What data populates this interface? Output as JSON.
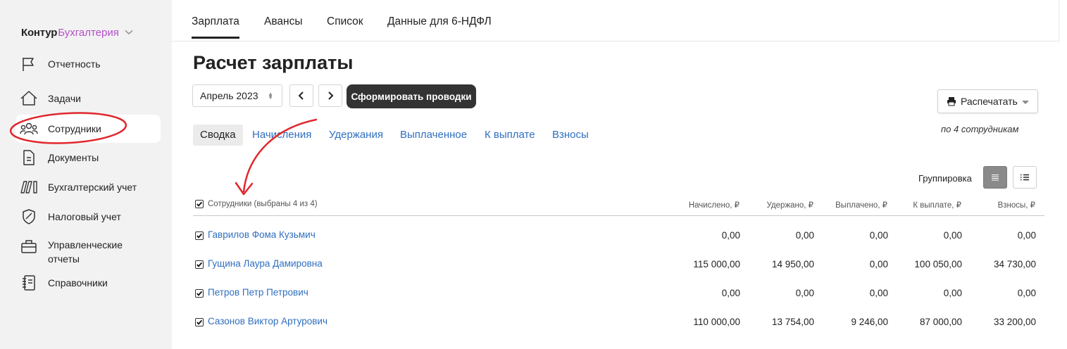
{
  "logo": {
    "kontur": "Контур",
    "product": "Бухгалтерия"
  },
  "sidebar": {
    "items": [
      {
        "label": "Отчетность",
        "icon": "flag-icon"
      },
      {
        "label": "Задачи",
        "icon": "home-icon"
      },
      {
        "label": "Сотрудники",
        "icon": "people-icon"
      },
      {
        "label": "Документы",
        "icon": "document-icon"
      },
      {
        "label": "Бухгалтерский учет",
        "icon": "ledger-icon"
      },
      {
        "label": "Налоговый учет",
        "icon": "shield-icon"
      },
      {
        "label": "Управленческие отчеты",
        "icon": "briefcase-icon"
      },
      {
        "label": "Справочники",
        "icon": "notebook-icon"
      }
    ]
  },
  "top_tabs": [
    "Зарплата",
    "Авансы",
    "Список",
    "Данные для 6-НДФЛ"
  ],
  "page": {
    "title": "Расчет зарплаты",
    "period": "Апрель 2023",
    "generate_button": "Сформировать проводки",
    "print_button": "Распечатать",
    "print_note": "по 4 сотрудникам",
    "grouping_label": "Группировка"
  },
  "sub_tabs": [
    "Сводка",
    "Начисления",
    "Удержания",
    "Выплаченное",
    "К выплате",
    "Взносы"
  ],
  "table": {
    "headers": {
      "employees": "Сотрудники (выбраны 4 из 4)",
      "accrued": "Начислено, ₽",
      "withheld": "Удержано, ₽",
      "paid": "Выплачено, ₽",
      "to_pay": "К выплате, ₽",
      "contributions": "Взносы, ₽"
    },
    "rows": [
      {
        "name": "Гаврилов Фома Кузьмич",
        "accrued": "0,00",
        "withheld": "0,00",
        "paid": "0,00",
        "to_pay": "0,00",
        "contributions": "0,00"
      },
      {
        "name": "Гущина Лаура Дамировна",
        "accrued": "115 000,00",
        "withheld": "14 950,00",
        "paid": "0,00",
        "to_pay": "100 050,00",
        "contributions": "34 730,00"
      },
      {
        "name": "Петров Петр Петрович",
        "accrued": "0,00",
        "withheld": "0,00",
        "paid": "0,00",
        "to_pay": "0,00",
        "contributions": "0,00"
      },
      {
        "name": "Сазонов Виктор Артурович",
        "accrued": "110 000,00",
        "withheld": "13 754,00",
        "paid": "9 246,00",
        "to_pay": "87 000,00",
        "contributions": "33 200,00"
      }
    ]
  },
  "colors": {
    "accent_link": "#2f6fbf",
    "brand_purple": "#b44fc7",
    "annotation_red": "#e0282e"
  }
}
